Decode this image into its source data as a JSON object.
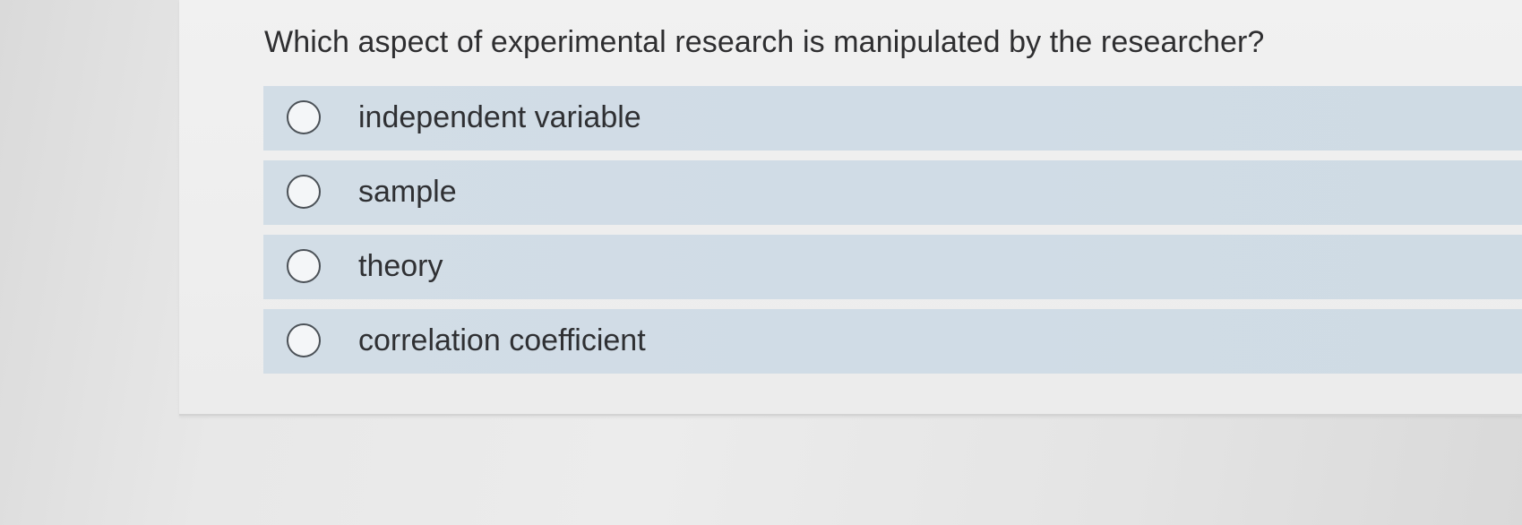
{
  "question": {
    "text": "Which aspect of experimental research is manipulated by the researcher?"
  },
  "options": [
    {
      "label": "independent variable",
      "selected": false
    },
    {
      "label": "sample",
      "selected": false
    },
    {
      "label": "theory",
      "selected": false
    },
    {
      "label": "correlation coefficient",
      "selected": false
    }
  ]
}
